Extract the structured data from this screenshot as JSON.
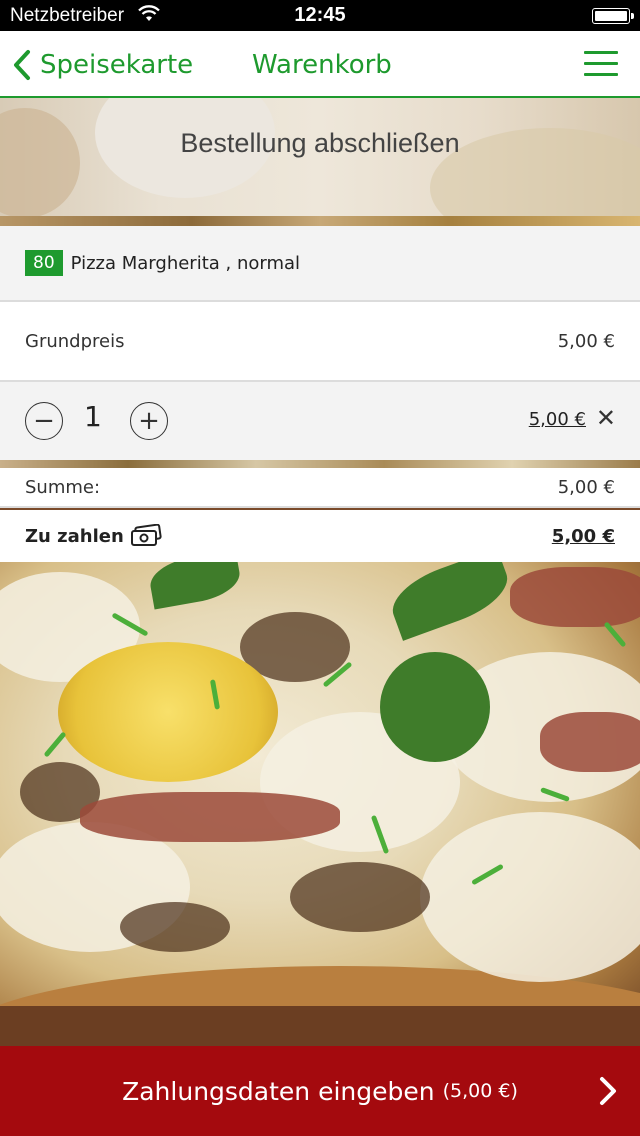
{
  "status_bar": {
    "carrier": "Netzbetreiber",
    "time": "12:45",
    "wifi_icon": "wifi-icon",
    "battery_icon": "battery-icon"
  },
  "nav": {
    "back_label": "Speisekarte",
    "title": "Warenkorb",
    "menu_icon": "hamburger-menu-icon",
    "accent_color": "#1e9a2e"
  },
  "banner": {
    "title": "Bestellung abschließen"
  },
  "cart": {
    "item": {
      "number": "80",
      "name": "Pizza Margherita , normal"
    },
    "base_price": {
      "label": "Grundpreis",
      "value": "5,00 €"
    },
    "quantity": {
      "minus": "−",
      "value": "1",
      "plus": "+",
      "line_total": "5,00 €",
      "remove": "✕"
    },
    "sum": {
      "label": "Summe:",
      "value": "5,00 €"
    },
    "to_pay": {
      "label": "Zu zahlen",
      "value": "5,00 €",
      "icon": "money-icon"
    }
  },
  "cta": {
    "label": "Zahlungsdaten eingeben",
    "amount": "(5,00 €)",
    "color": "#a40a0e",
    "icon": "chevron-right-icon"
  }
}
